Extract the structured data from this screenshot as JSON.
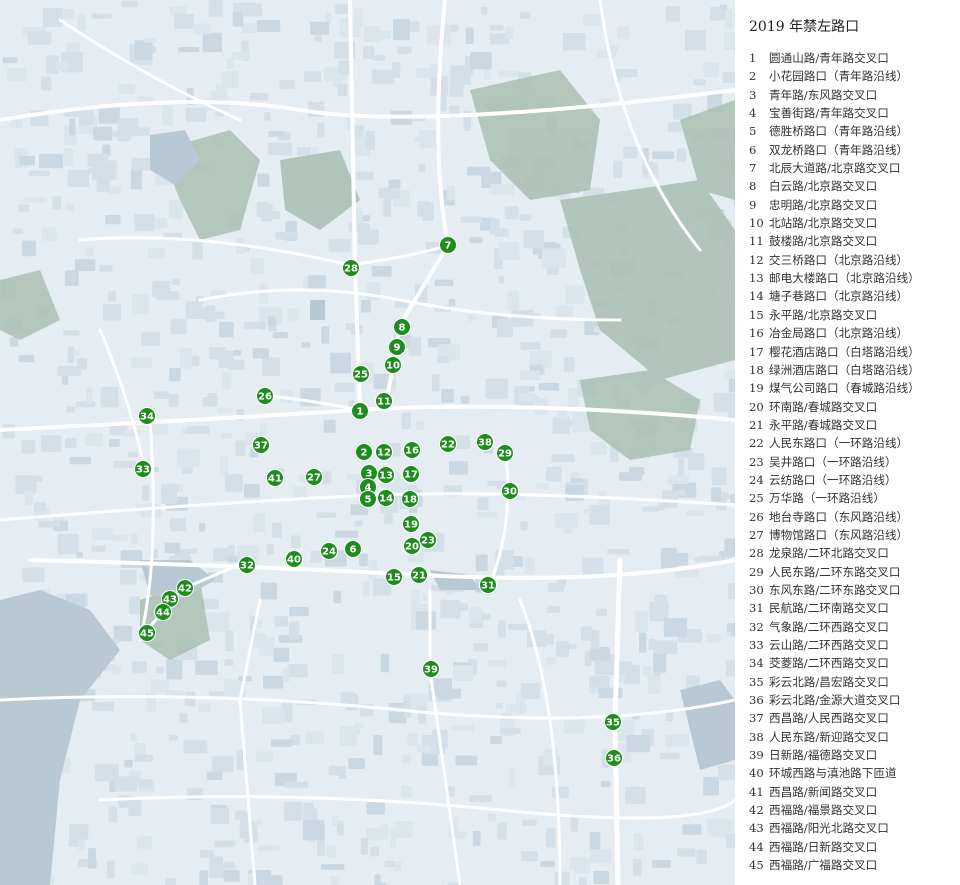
{
  "legend": {
    "title": "2019 年禁左路口",
    "items": [
      {
        "number": "1",
        "name": "圆通山路/青年路交叉口"
      },
      {
        "number": "2",
        "name": "小花园路口（青年路沿线）"
      },
      {
        "number": "3",
        "name": "青年路/东风路交叉口"
      },
      {
        "number": "4",
        "name": "宝善街路/青年路交叉口"
      },
      {
        "number": "5",
        "name": "德胜桥路口（青年路沿线）"
      },
      {
        "number": "6",
        "name": "双龙桥路口（青年路沿线）"
      },
      {
        "number": "7",
        "name": "北辰大道路/北京路交叉口"
      },
      {
        "number": "8",
        "name": "白云路/北京路交叉口"
      },
      {
        "number": "9",
        "name": "忠明路/北京路交叉口"
      },
      {
        "number": "10",
        "name": "北站路/北京路交叉口"
      },
      {
        "number": "11",
        "name": "鼓楼路/北京路交叉口"
      },
      {
        "number": "12",
        "name": "交三桥路口（北京路沿线）"
      },
      {
        "number": "13",
        "name": "邮电大楼路口（北京路沿线）"
      },
      {
        "number": "14",
        "name": "塘子巷路口（北京路沿线）"
      },
      {
        "number": "15",
        "name": "永平路/北京路交叉口"
      },
      {
        "number": "16",
        "name": "冶金局路口（北京路沿线）"
      },
      {
        "number": "17",
        "name": "樱花酒店路口（白塔路沿线）"
      },
      {
        "number": "18",
        "name": "绿洲酒店路口（白塔路沿线）"
      },
      {
        "number": "19",
        "name": "煤气公司路口（春城路沿线）"
      },
      {
        "number": "20",
        "name": "环南路/春城路交叉口"
      },
      {
        "number": "21",
        "name": "永平路/春城路交叉口"
      },
      {
        "number": "22",
        "name": "人民东路口（一环路沿线）"
      },
      {
        "number": "23",
        "name": "吴井路口（一环路沿线）"
      },
      {
        "number": "24",
        "name": "云纺路口（一环路沿线）"
      },
      {
        "number": "25",
        "name": "万华路（一环路沿线）"
      },
      {
        "number": "26",
        "name": "地台寺路口（东风路沿线）"
      },
      {
        "number": "27",
        "name": "博物馆路口（东风路沿线）"
      },
      {
        "number": "28",
        "name": "龙泉路/二环北路交叉口"
      },
      {
        "number": "29",
        "name": "人民东路/二环东路交叉口"
      },
      {
        "number": "30",
        "name": "东风东路/二环东路交叉口"
      },
      {
        "number": "31",
        "name": "民航路/二环南路交叉口"
      },
      {
        "number": "32",
        "name": "气象路/二环西路交叉口"
      },
      {
        "number": "33",
        "name": "云山路/二环西路交叉口"
      },
      {
        "number": "34",
        "name": "茭菱路/二环西路交叉口"
      },
      {
        "number": "35",
        "name": "彩云北路/昌宏路交叉口"
      },
      {
        "number": "36",
        "name": "彩云北路/金源大道交叉口"
      },
      {
        "number": "37",
        "name": "西昌路/人民西路交叉口"
      },
      {
        "number": "38",
        "name": "人民东路/新迎路交叉口"
      },
      {
        "number": "39",
        "name": "日新路/福德路交叉口"
      },
      {
        "number": "40",
        "name": "环城西路与滇池路下匝道"
      },
      {
        "number": "41",
        "name": "西昌路/新闻路交叉口"
      },
      {
        "number": "42",
        "name": "西福路/福景路交叉口"
      },
      {
        "number": "43",
        "name": "西福路/阳光北路交叉口"
      },
      {
        "number": "44",
        "name": "西福路/日新路交叉口"
      },
      {
        "number": "45",
        "name": "西福路/广福路交叉口"
      }
    ]
  },
  "map": {
    "marker_color": "#1e8c1e",
    "marker_text_color": "#ffffff",
    "water_color": "#b9c9d3",
    "green_color": "#a9bfb3",
    "land_color": "#e6edf2",
    "markers": [
      "1",
      "2",
      "3",
      "4",
      "5",
      "6",
      "7",
      "8",
      "9",
      "10",
      "11",
      "12",
      "13",
      "14",
      "15",
      "16",
      "17",
      "18",
      "19",
      "20",
      "21",
      "22",
      "23",
      "24",
      "25",
      "26",
      "27",
      "28",
      "29",
      "30",
      "31",
      "32",
      "33",
      "34",
      "35",
      "36",
      "37",
      "38",
      "39",
      "40",
      "41",
      "42",
      "43",
      "44",
      "45"
    ]
  }
}
